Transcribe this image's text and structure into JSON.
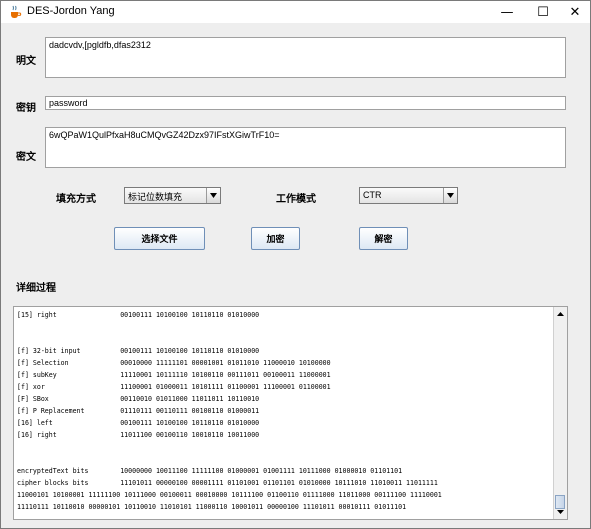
{
  "window": {
    "title": "DES-Jordon Yang",
    "minimize_glyph": "—",
    "maximize_glyph": "☐",
    "close_glyph": "✕"
  },
  "fields": {
    "plaintext_label": "明文",
    "plaintext_value": "dadcvdv,[pgldfb,dfas2312",
    "key_label": "密钥",
    "key_value": "password",
    "ciphertext_label": "密文",
    "ciphertext_value": "6wQPaW1QulPfxaH8uCMQvGZ42Dzx97IFstXGiwTrF10="
  },
  "options": {
    "padding_label": "填充方式",
    "padding_value": "标记位数填充",
    "mode_label": "工作模式",
    "mode_value": "CTR"
  },
  "buttons": {
    "select_file": "选择文件",
    "encrypt": "加密",
    "decrypt": "解密"
  },
  "details_label": "详细过程",
  "log_lines": [
    "[15] right                00100111 10100100 10110110 01010000",
    "",
    "",
    "[f] 32-bit input          00100111 10100100 10110110 01010000",
    "[f] Selection             00010000 11111101 00001001 01011010 11000010 10100000",
    "[f] subKey                11110001 10111110 10100110 00111011 00100011 11000001",
    "[f] xor                   11100001 01000011 10101111 01100001 11100001 01100001",
    "[F] SBox                  00110010 01011000 11011011 10110010",
    "[f] P Replacement         01110111 00110111 00100110 01000011",
    "[16] left                 00100111 10100100 10110110 01010000",
    "[16] right                11011100 00100110 10010110 10011000",
    "",
    "",
    "encryptedText bits        10000000 10011100 11111100 01000001 01001111 10111000 01000010 01101101",
    "cipher blocks bits        11101011 00000100 00001111 01101001 01101101 01010000 10111010 11010011 11011111",
    "11000101 10100001 11111100 10111000 00100011 00010000 10111100 01100110 01111000 11011000 00111100 11110001",
    "11110111 10110010 00000101 10110010 11010101 11000110 10001011 00000100 11101011 00010111 01011101"
  ],
  "icons": {
    "app": "java-cup-icon",
    "dropdown": "chevron-down-icon",
    "scroll_up": "arrow-up-icon",
    "scroll_down": "arrow-down-icon"
  },
  "colors": {
    "window_bg": "#eeeeee",
    "button_border": "#6f8fb7",
    "field_border": "#a0a0a0"
  }
}
